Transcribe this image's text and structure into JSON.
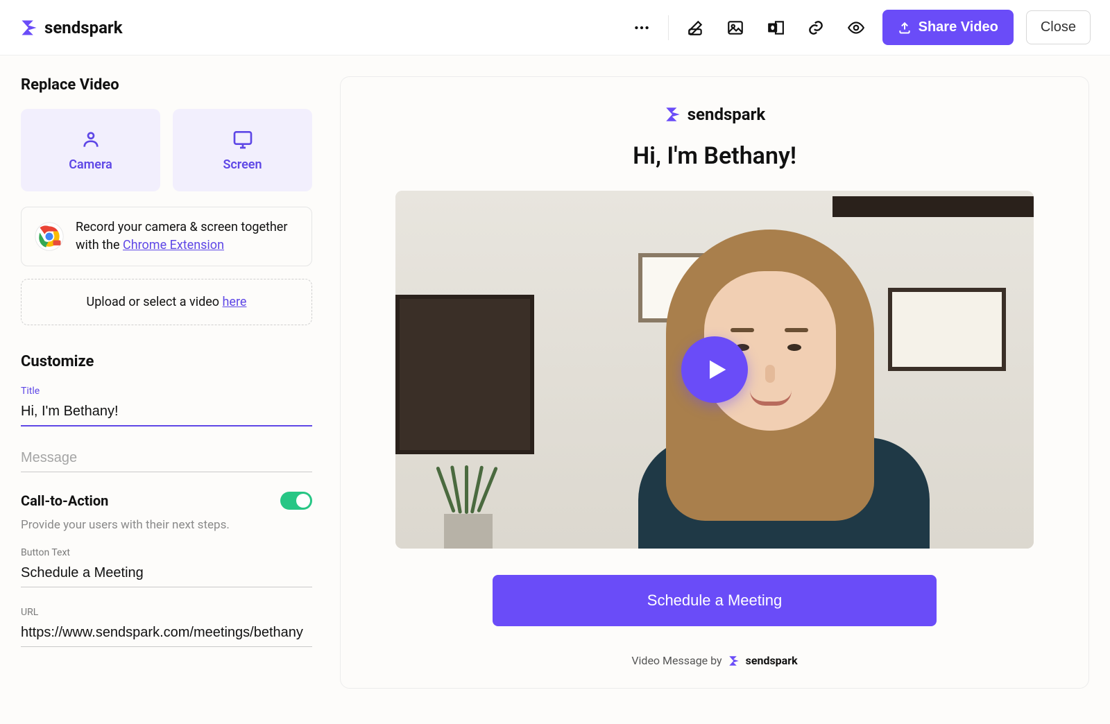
{
  "brand": "sendspark",
  "header": {
    "share_label": "Share Video",
    "close_label": "Close"
  },
  "sidebar": {
    "replace_title": "Replace Video",
    "record": {
      "camera_label": "Camera",
      "screen_label": "Screen"
    },
    "chrome_ext": {
      "text_prefix": "Record your camera & screen together with the ",
      "link": "Chrome Extension"
    },
    "upload_text_prefix": "Upload or select a video ",
    "upload_link": "here",
    "customize_title": "Customize",
    "title_field_label": "Title",
    "title_value": "Hi, I'm Bethany!",
    "message_placeholder": "Message",
    "cta_title": "Call-to-Action",
    "cta_hint": "Provide your users with their next steps.",
    "button_text_label": "Button Text",
    "button_text_value": "Schedule a Meeting",
    "url_label": "URL",
    "url_value": "https://www.sendspark.com/meetings/bethany"
  },
  "preview": {
    "title": "Hi, I'm Bethany!",
    "cta_label": "Schedule a Meeting",
    "footer_prefix": "Video Message by",
    "footer_brand": "sendspark"
  }
}
